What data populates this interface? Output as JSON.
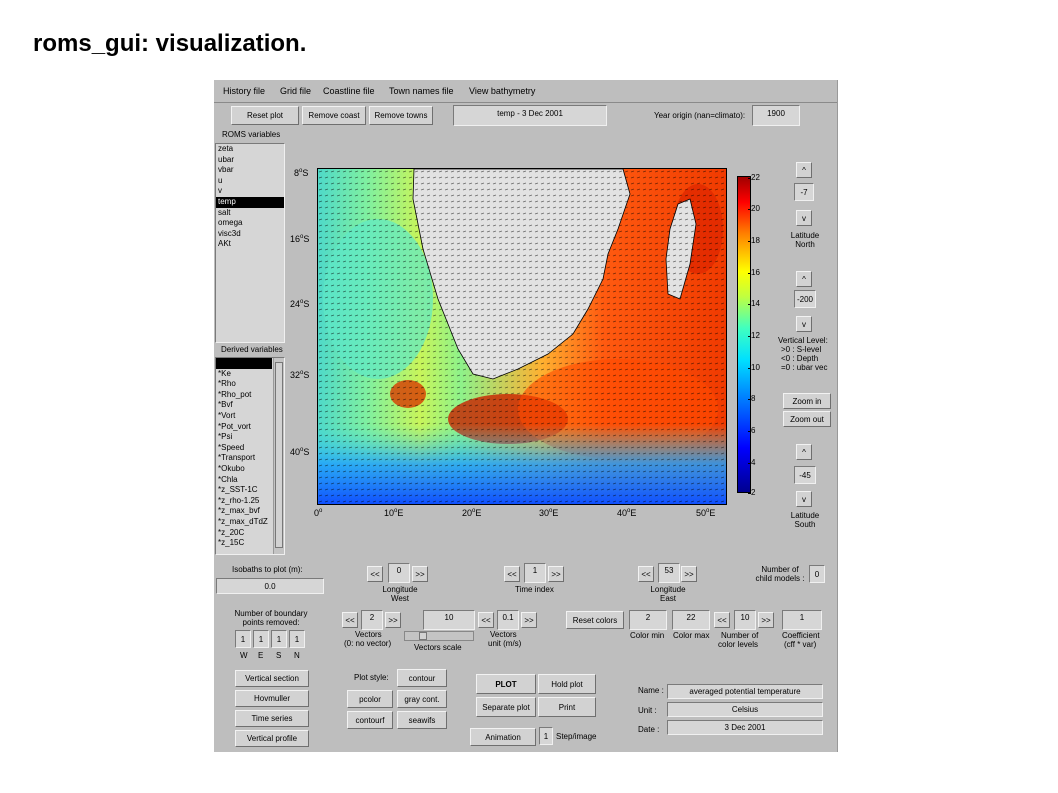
{
  "page_title": "roms_gui: visualization.",
  "menu": [
    "History file",
    "Grid file",
    "Coastline file",
    "Town names file",
    "View bathymetry"
  ],
  "toolbar": {
    "reset_plot": "Reset plot",
    "remove_coast": "Remove coast",
    "remove_towns": "Remove towns",
    "plot_title": "temp - 3 Dec 2001",
    "year_origin_label": "Year origin (nan=climato):",
    "year_origin_value": "1900"
  },
  "roms_variables": {
    "label": "ROMS variables",
    "items": [
      "zeta",
      "ubar",
      "vbar",
      "u",
      "v",
      "temp",
      "salt",
      "omega",
      "visc3d",
      "AKt"
    ],
    "selected": "temp"
  },
  "derived_variables": {
    "label": "Derived variables",
    "items": [
      "",
      "*Ke",
      "*Rho",
      "*Rho_pot",
      "*Bvf",
      "*Vort",
      "*Pot_vort",
      "*Psi",
      "*Speed",
      "*Transport",
      "*Okubo",
      "*Chla",
      "*z_SST-1C",
      "*z_rho-1.25",
      "*z_max_bvf",
      "*z_max_dTdZ",
      "*z_20C",
      "*z_15C"
    ]
  },
  "isobaths": {
    "label": "Isobaths to plot (m):",
    "value": "0.0"
  },
  "boundary": {
    "label": "Number of boundary points removed:",
    "values": [
      "1",
      "1",
      "1",
      "1"
    ],
    "dirs": [
      "W",
      "E",
      "S",
      "N"
    ]
  },
  "map": {
    "lat_ticks": [
      "8",
      "16",
      "24",
      "32",
      "40"
    ],
    "lat_unit": "S",
    "lon_ticks": [
      "0",
      "10",
      "20",
      "30",
      "40",
      "50"
    ],
    "lon_unit": "E"
  },
  "colorbar": {
    "ticks": [
      "22",
      "20",
      "18",
      "16",
      "14",
      "12",
      "10",
      "8",
      "6",
      "4",
      "2"
    ],
    "min": 2,
    "max": 22
  },
  "lat_north": {
    "up": "^",
    "value": "-7",
    "down": "v",
    "label": "Latitude North"
  },
  "vertical": {
    "up": "^",
    "value": "-200",
    "down": "v",
    "label": "Vertical Level:",
    "legend": [
      ">0 : S-level",
      "<0 : Depth",
      "=0 : ubar vec"
    ]
  },
  "zoom": {
    "in": "Zoom in",
    "out": "Zoom out"
  },
  "lat_south": {
    "up": "^",
    "value": "-45",
    "down": "v",
    "label": "Latitude South"
  },
  "lon_west": {
    "prev": "<<",
    "value": "0",
    "next": ">>",
    "label": "Longitude West"
  },
  "time_index": {
    "prev": "<<",
    "value": "1",
    "next": ">>",
    "label": "Time index"
  },
  "lon_east": {
    "prev": "<<",
    "value": "53",
    "next": ">>",
    "label": "Longitude East"
  },
  "child_models": {
    "label": "Number of child models :",
    "value": "0"
  },
  "vectors": {
    "prev": "<<",
    "value": "2",
    "next": ">>",
    "label": "Vectors",
    "sublabel": "(0: no vector)"
  },
  "vectors_scale": {
    "value": "10",
    "label": "Vectors scale"
  },
  "vectors_unit": {
    "prev": "<<",
    "value": "0.1",
    "next": ">>",
    "label": "Vectors",
    "sublabel": "unit (m/s)"
  },
  "color": {
    "reset": "Reset colors",
    "min": "2",
    "min_label": "Color min",
    "max": "22",
    "max_label": "Color max",
    "prev": "<<",
    "levels": "10",
    "next": ">>",
    "levels_label": "Number of",
    "levels_sublabel": "color levels",
    "coef": "1",
    "coef_label": "Coefficient",
    "coef_sublabel": "(cff * var)"
  },
  "sections": [
    "Vertical section",
    "Hovmuller",
    "Time series",
    "Vertical profile"
  ],
  "plot_style": {
    "label": "Plot style:",
    "buttons": [
      "contour",
      "pcolor",
      "gray cont.",
      "contourf",
      "seawifs"
    ]
  },
  "actions": {
    "plot": "PLOT",
    "hold": "Hold plot",
    "separate": "Separate plot",
    "print": "Print",
    "animation": "Animation",
    "step": "1",
    "step_label": "Step/image"
  },
  "info": {
    "name_label": "Name :",
    "name": "averaged potential temperature",
    "unit_label": "Unit :",
    "unit": "Celsius",
    "date_label": "Date :",
    "date": "3 Dec 2001"
  }
}
